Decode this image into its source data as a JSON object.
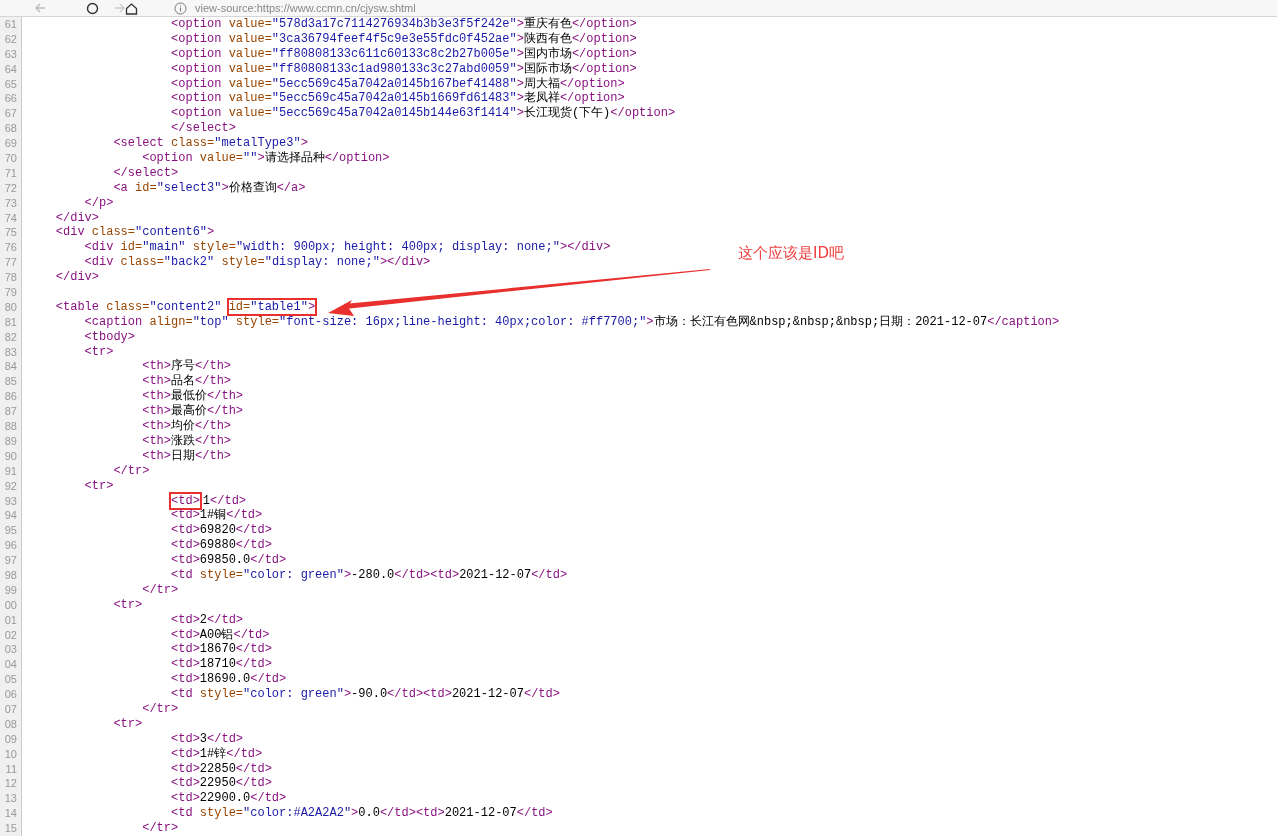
{
  "toolbar": {
    "address": "view-source:https://www.ccmn.cn/cjysw.shtml"
  },
  "annotation": {
    "text": "这个应该是ID吧"
  },
  "lines": [
    {
      "number": "61",
      "tokens": [
        {
          "kind": "tag",
          "text": "                    <option"
        },
        {
          "kind": "attr",
          "text": " value="
        },
        {
          "kind": "value",
          "text": "\"578d3a17c7114276934b3b3e3f5f242e\""
        },
        {
          "kind": "tag",
          "text": ">"
        },
        {
          "kind": "text",
          "text": "重庆有色"
        },
        {
          "kind": "tag",
          "text": "</option>"
        }
      ]
    },
    {
      "number": "62",
      "tokens": [
        {
          "kind": "tag",
          "text": "                    <option"
        },
        {
          "kind": "attr",
          "text": " value="
        },
        {
          "kind": "value",
          "text": "\"3ca36794feef4f5c9e3e55fdc0f452ae\""
        },
        {
          "kind": "tag",
          "text": ">"
        },
        {
          "kind": "text",
          "text": "陕西有色"
        },
        {
          "kind": "tag",
          "text": "</option>"
        }
      ]
    },
    {
      "number": "63",
      "tokens": [
        {
          "kind": "tag",
          "text": "                    <option"
        },
        {
          "kind": "attr",
          "text": " value="
        },
        {
          "kind": "value",
          "text": "\"ff80808133c611c60133c8c2b27b005e\""
        },
        {
          "kind": "tag",
          "text": ">"
        },
        {
          "kind": "text",
          "text": "国内市场"
        },
        {
          "kind": "tag",
          "text": "</option>"
        }
      ]
    },
    {
      "number": "64",
      "tokens": [
        {
          "kind": "tag",
          "text": "                    <option"
        },
        {
          "kind": "attr",
          "text": " value="
        },
        {
          "kind": "value",
          "text": "\"ff80808133c1ad980133c3c27abd0059\""
        },
        {
          "kind": "tag",
          "text": ">"
        },
        {
          "kind": "text",
          "text": "国际市场"
        },
        {
          "kind": "tag",
          "text": "</option>"
        }
      ]
    },
    {
      "number": "65",
      "tokens": [
        {
          "kind": "tag",
          "text": "                    <option"
        },
        {
          "kind": "attr",
          "text": " value="
        },
        {
          "kind": "value",
          "text": "\"5ecc569c45a7042a0145b167bef41488\""
        },
        {
          "kind": "tag",
          "text": ">"
        },
        {
          "kind": "text",
          "text": "周大福"
        },
        {
          "kind": "tag",
          "text": "</option>"
        }
      ]
    },
    {
      "number": "66",
      "tokens": [
        {
          "kind": "tag",
          "text": "                    <option"
        },
        {
          "kind": "attr",
          "text": " value="
        },
        {
          "kind": "value",
          "text": "\"5ecc569c45a7042a0145b1669fd61483\""
        },
        {
          "kind": "tag",
          "text": ">"
        },
        {
          "kind": "text",
          "text": "老凤祥"
        },
        {
          "kind": "tag",
          "text": "</option>"
        }
      ]
    },
    {
      "number": "67",
      "tokens": [
        {
          "kind": "tag",
          "text": "                    <option"
        },
        {
          "kind": "attr",
          "text": " value="
        },
        {
          "kind": "value",
          "text": "\"5ecc569c45a7042a0145b144e63f1414\""
        },
        {
          "kind": "tag",
          "text": ">"
        },
        {
          "kind": "text",
          "text": "长江现货(下午)"
        },
        {
          "kind": "tag",
          "text": "</option>"
        }
      ]
    },
    {
      "number": "68",
      "tokens": [
        {
          "kind": "tag",
          "text": "                    </select>"
        }
      ]
    },
    {
      "number": "69",
      "tokens": [
        {
          "kind": "tag",
          "text": "            <select"
        },
        {
          "kind": "attr",
          "text": " class="
        },
        {
          "kind": "value",
          "text": "\"metalType3\""
        },
        {
          "kind": "tag",
          "text": ">"
        }
      ]
    },
    {
      "number": "70",
      "tokens": [
        {
          "kind": "tag",
          "text": "                <option"
        },
        {
          "kind": "attr",
          "text": " value="
        },
        {
          "kind": "value",
          "text": "\"\""
        },
        {
          "kind": "tag",
          "text": ">"
        },
        {
          "kind": "text",
          "text": "请选择品种"
        },
        {
          "kind": "tag",
          "text": "</option>"
        }
      ]
    },
    {
      "number": "71",
      "tokens": [
        {
          "kind": "tag",
          "text": "            </select>"
        }
      ]
    },
    {
      "number": "72",
      "tokens": [
        {
          "kind": "tag",
          "text": "            <a"
        },
        {
          "kind": "attr",
          "text": " id="
        },
        {
          "kind": "value",
          "text": "\"select3\""
        },
        {
          "kind": "tag",
          "text": ">"
        },
        {
          "kind": "text",
          "text": "价格查询"
        },
        {
          "kind": "tag",
          "text": "</a>"
        }
      ]
    },
    {
      "number": "73",
      "tokens": [
        {
          "kind": "tag",
          "text": "        </p>"
        }
      ]
    },
    {
      "number": "74",
      "tokens": [
        {
          "kind": "tag",
          "text": "    </div>"
        }
      ]
    },
    {
      "number": "75",
      "tokens": [
        {
          "kind": "tag",
          "text": "    <div"
        },
        {
          "kind": "attr",
          "text": " class="
        },
        {
          "kind": "value",
          "text": "\"content6\""
        },
        {
          "kind": "tag",
          "text": ">"
        }
      ]
    },
    {
      "number": "76",
      "tokens": [
        {
          "kind": "tag",
          "text": "        <div"
        },
        {
          "kind": "attr",
          "text": " id="
        },
        {
          "kind": "value",
          "text": "\"main\""
        },
        {
          "kind": "attr",
          "text": " style="
        },
        {
          "kind": "value",
          "text": "\"width: 900px; height: 400px; display: none;\""
        },
        {
          "kind": "tag",
          "text": "></div>"
        }
      ]
    },
    {
      "number": "77",
      "tokens": [
        {
          "kind": "tag",
          "text": "        <div"
        },
        {
          "kind": "attr",
          "text": " class="
        },
        {
          "kind": "value",
          "text": "\"back2\""
        },
        {
          "kind": "attr",
          "text": " style="
        },
        {
          "kind": "value",
          "text": "\"display: none;\""
        },
        {
          "kind": "tag",
          "text": "></div>"
        }
      ]
    },
    {
      "number": "78",
      "tokens": [
        {
          "kind": "tag",
          "text": "    </div>"
        }
      ]
    },
    {
      "number": "79"
    },
    {
      "number": "80",
      "tokens": [
        {
          "kind": "tag",
          "text": "    <table"
        },
        {
          "kind": "attr",
          "text": " class="
        },
        {
          "kind": "value",
          "text": "\"content2\""
        },
        {
          "kind": "attr",
          "text": " id=",
          "highlighted": true
        },
        {
          "kind": "value",
          "text": "\"table1\"",
          "highlighted": true
        },
        {
          "kind": "tag",
          "text": ">",
          "highlighted": true
        }
      ]
    },
    {
      "number": "81",
      "tokens": [
        {
          "kind": "tag",
          "text": "        <caption"
        },
        {
          "kind": "attr",
          "text": " align="
        },
        {
          "kind": "value",
          "text": "\"top\""
        },
        {
          "kind": "attr",
          "text": " style="
        },
        {
          "kind": "value",
          "text": "\"font-size: 16px;line-height: 40px;color: #ff7700;\""
        },
        {
          "kind": "tag",
          "text": ">"
        },
        {
          "kind": "text",
          "text": "市场：长江有色网&nbsp;&nbsp;&nbsp;日期：2021-12-07"
        },
        {
          "kind": "tag",
          "text": "</caption>"
        }
      ]
    },
    {
      "number": "82",
      "tokens": [
        {
          "kind": "tag",
          "text": "        <tbody>"
        }
      ]
    },
    {
      "number": "83",
      "tokens": [
        {
          "kind": "tag",
          "text": "        <tr>"
        }
      ]
    },
    {
      "number": "84",
      "tokens": [
        {
          "kind": "tag",
          "text": "                <th>"
        },
        {
          "kind": "text",
          "text": "序号"
        },
        {
          "kind": "tag",
          "text": "</th>"
        }
      ]
    },
    {
      "number": "85",
      "tokens": [
        {
          "kind": "tag",
          "text": "                <th>"
        },
        {
          "kind": "text",
          "text": "品名"
        },
        {
          "kind": "tag",
          "text": "</th>"
        }
      ]
    },
    {
      "number": "86",
      "tokens": [
        {
          "kind": "tag",
          "text": "                <th>"
        },
        {
          "kind": "text",
          "text": "最低价"
        },
        {
          "kind": "tag",
          "text": "</th>"
        }
      ]
    },
    {
      "number": "87",
      "tokens": [
        {
          "kind": "tag",
          "text": "                <th>"
        },
        {
          "kind": "text",
          "text": "最高价"
        },
        {
          "kind": "tag",
          "text": "</th>"
        }
      ]
    },
    {
      "number": "88",
      "tokens": [
        {
          "kind": "tag",
          "text": "                <th>"
        },
        {
          "kind": "text",
          "text": "均价"
        },
        {
          "kind": "tag",
          "text": "</th>"
        }
      ]
    },
    {
      "number": "89",
      "tokens": [
        {
          "kind": "tag",
          "text": "                <th>"
        },
        {
          "kind": "text",
          "text": "涨跌"
        },
        {
          "kind": "tag",
          "text": "</th>"
        }
      ]
    },
    {
      "number": "90",
      "tokens": [
        {
          "kind": "tag",
          "text": "                <th>"
        },
        {
          "kind": "text",
          "text": "日期"
        },
        {
          "kind": "tag",
          "text": "</th>"
        }
      ]
    },
    {
      "number": "91",
      "tokens": [
        {
          "kind": "tag",
          "text": "            </tr>"
        }
      ]
    },
    {
      "number": "92",
      "tokens": [
        {
          "kind": "tag",
          "text": "        <tr>"
        }
      ]
    },
    {
      "number": "93",
      "tokens": [
        {
          "kind": "tag",
          "text": "                    <td>",
          "highlighted": true
        },
        {
          "kind": "text",
          "text": "1"
        },
        {
          "kind": "tag",
          "text": "</td>"
        }
      ]
    },
    {
      "number": "94",
      "tokens": [
        {
          "kind": "tag",
          "text": "                    <td>"
        },
        {
          "kind": "text",
          "text": "1#铜"
        },
        {
          "kind": "tag",
          "text": "</td>"
        }
      ]
    },
    {
      "number": "95",
      "tokens": [
        {
          "kind": "tag",
          "text": "                    <td>"
        },
        {
          "kind": "text",
          "text": "69820"
        },
        {
          "kind": "tag",
          "text": "</td>"
        }
      ]
    },
    {
      "number": "96",
      "tokens": [
        {
          "kind": "tag",
          "text": "                    <td>"
        },
        {
          "kind": "text",
          "text": "69880"
        },
        {
          "kind": "tag",
          "text": "</td>"
        }
      ]
    },
    {
      "number": "97",
      "tokens": [
        {
          "kind": "tag",
          "text": "                    <td>"
        },
        {
          "kind": "text",
          "text": "69850.0"
        },
        {
          "kind": "tag",
          "text": "</td>"
        }
      ]
    },
    {
      "number": "98",
      "tokens": [
        {
          "kind": "tag",
          "text": "                    <td"
        },
        {
          "kind": "attr",
          "text": " style="
        },
        {
          "kind": "value",
          "text": "\"color: green\""
        },
        {
          "kind": "tag",
          "text": ">"
        },
        {
          "kind": "text",
          "text": "-280.0"
        },
        {
          "kind": "tag",
          "text": "</td><td>"
        },
        {
          "kind": "text",
          "text": "2021-12-07"
        },
        {
          "kind": "tag",
          "text": "</td>"
        }
      ]
    },
    {
      "number": "99",
      "tokens": [
        {
          "kind": "tag",
          "text": "                </tr>"
        }
      ]
    },
    {
      "number": "00",
      "tokens": [
        {
          "kind": "tag",
          "text": "            <tr>"
        }
      ]
    },
    {
      "number": "01",
      "tokens": [
        {
          "kind": "tag",
          "text": "                    <td>"
        },
        {
          "kind": "text",
          "text": "2"
        },
        {
          "kind": "tag",
          "text": "</td>"
        }
      ]
    },
    {
      "number": "02",
      "tokens": [
        {
          "kind": "tag",
          "text": "                    <td>"
        },
        {
          "kind": "text",
          "text": "A00铝"
        },
        {
          "kind": "tag",
          "text": "</td>"
        }
      ]
    },
    {
      "number": "03",
      "tokens": [
        {
          "kind": "tag",
          "text": "                    <td>"
        },
        {
          "kind": "text",
          "text": "18670"
        },
        {
          "kind": "tag",
          "text": "</td>"
        }
      ]
    },
    {
      "number": "04",
      "tokens": [
        {
          "kind": "tag",
          "text": "                    <td>"
        },
        {
          "kind": "text",
          "text": "18710"
        },
        {
          "kind": "tag",
          "text": "</td>"
        }
      ]
    },
    {
      "number": "05",
      "tokens": [
        {
          "kind": "tag",
          "text": "                    <td>"
        },
        {
          "kind": "text",
          "text": "18690.0"
        },
        {
          "kind": "tag",
          "text": "</td>"
        }
      ]
    },
    {
      "number": "06",
      "tokens": [
        {
          "kind": "tag",
          "text": "                    <td"
        },
        {
          "kind": "attr",
          "text": " style="
        },
        {
          "kind": "value",
          "text": "\"color: green\""
        },
        {
          "kind": "tag",
          "text": ">"
        },
        {
          "kind": "text",
          "text": "-90.0"
        },
        {
          "kind": "tag",
          "text": "</td><td>"
        },
        {
          "kind": "text",
          "text": "2021-12-07"
        },
        {
          "kind": "tag",
          "text": "</td>"
        }
      ]
    },
    {
      "number": "07",
      "tokens": [
        {
          "kind": "tag",
          "text": "                </tr>"
        }
      ]
    },
    {
      "number": "08",
      "tokens": [
        {
          "kind": "tag",
          "text": "            <tr>"
        }
      ]
    },
    {
      "number": "09",
      "tokens": [
        {
          "kind": "tag",
          "text": "                    <td>"
        },
        {
          "kind": "text",
          "text": "3"
        },
        {
          "kind": "tag",
          "text": "</td>"
        }
      ]
    },
    {
      "number": "10",
      "tokens": [
        {
          "kind": "tag",
          "text": "                    <td>"
        },
        {
          "kind": "text",
          "text": "1#锌"
        },
        {
          "kind": "tag",
          "text": "</td>"
        }
      ]
    },
    {
      "number": "11",
      "tokens": [
        {
          "kind": "tag",
          "text": "                    <td>"
        },
        {
          "kind": "text",
          "text": "22850"
        },
        {
          "kind": "tag",
          "text": "</td>"
        }
      ]
    },
    {
      "number": "12",
      "tokens": [
        {
          "kind": "tag",
          "text": "                    <td>"
        },
        {
          "kind": "text",
          "text": "22950"
        },
        {
          "kind": "tag",
          "text": "</td>"
        }
      ]
    },
    {
      "number": "13",
      "tokens": [
        {
          "kind": "tag",
          "text": "                    <td>"
        },
        {
          "kind": "text",
          "text": "22900.0"
        },
        {
          "kind": "tag",
          "text": "</td>"
        }
      ]
    },
    {
      "number": "14",
      "tokens": [
        {
          "kind": "tag",
          "text": "                    <td"
        },
        {
          "kind": "attr",
          "text": " style="
        },
        {
          "kind": "value",
          "text": "\"color:#A2A2A2\""
        },
        {
          "kind": "tag",
          "text": ">"
        },
        {
          "kind": "text",
          "text": "0.0"
        },
        {
          "kind": "tag",
          "text": "</td><td>"
        },
        {
          "kind": "text",
          "text": "2021-12-07"
        },
        {
          "kind": "tag",
          "text": "</td>"
        }
      ]
    },
    {
      "number": "15",
      "tokens": [
        {
          "kind": "tag",
          "text": "                </tr>"
        }
      ]
    }
  ]
}
